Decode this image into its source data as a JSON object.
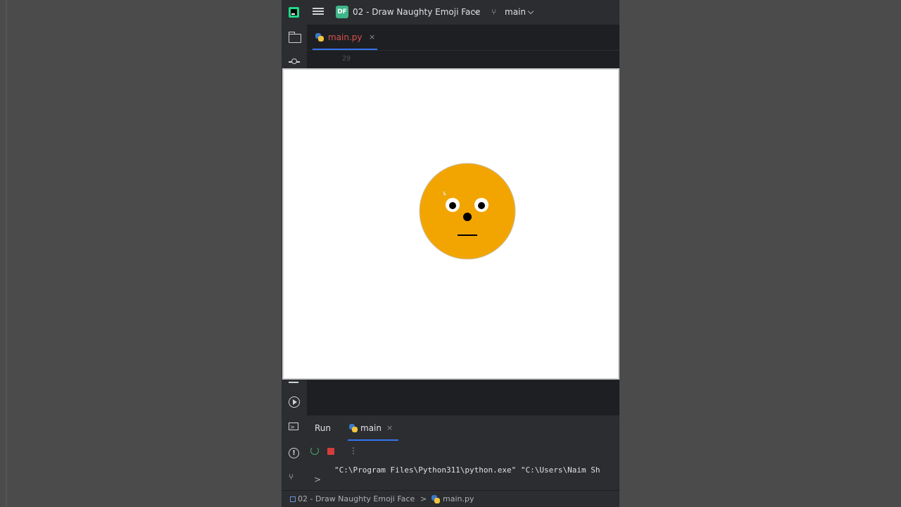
{
  "titlebar": {
    "project_badge": "DF",
    "project_name": "02 - Draw Naughty Emoji Face",
    "branch": "main",
    "icons": [
      "app-logo-icon",
      "hamburger-menu-icon",
      "branch-icon",
      "chevron-down-icon"
    ]
  },
  "editor": {
    "tab_label": "main.py",
    "tab_close": "×",
    "line_number": "29"
  },
  "turtle_window": {
    "face_color": "#f2a500",
    "eye_white": "#ffffff",
    "pupil_color": "#000000",
    "background": "#ffffff"
  },
  "run_panel": {
    "title": "Run",
    "tab_label": "main",
    "tab_close": "×",
    "console_line": "\"C:\\Program Files\\Python311\\python.exe\" \"C:\\Users\\Naim Sh",
    "prompt": ">"
  },
  "status_bar": {
    "project": "02 - Draw Naughty Emoji Face",
    "separator": ">",
    "file": "main.py"
  },
  "colors": {
    "accent": "#3574f0",
    "tab_modified": "#d9534f",
    "stop": "#d63c3c",
    "rerun": "#4aa866"
  }
}
